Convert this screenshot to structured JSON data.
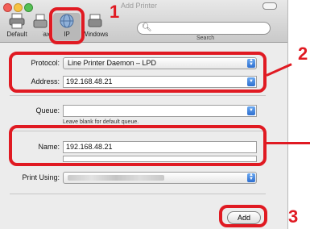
{
  "window": {
    "title": "Add Printer"
  },
  "toolbar": {
    "default_label": "Default",
    "fax_label": "Fax",
    "ip_label": "IP",
    "windows_label": "Windows",
    "search_placeholder": "",
    "search_caption": "Search"
  },
  "form": {
    "protocol_label": "Protocol:",
    "protocol_value": "Line Printer Daemon – LPD",
    "address_label": "Address:",
    "address_value": "192.168.48.21",
    "queue_label": "Queue:",
    "queue_value": "",
    "queue_hint": "Leave blank for default queue.",
    "name_label": "Name:",
    "name_value": "192.168.48.21",
    "location_value": "",
    "print_using_label": "Print Using:",
    "add_label": "Add"
  },
  "callouts": {
    "step1": "1",
    "step2": "2",
    "step3": "3"
  },
  "colors": {
    "highlight": "#e01a22",
    "accent": "#2e6fd0"
  }
}
